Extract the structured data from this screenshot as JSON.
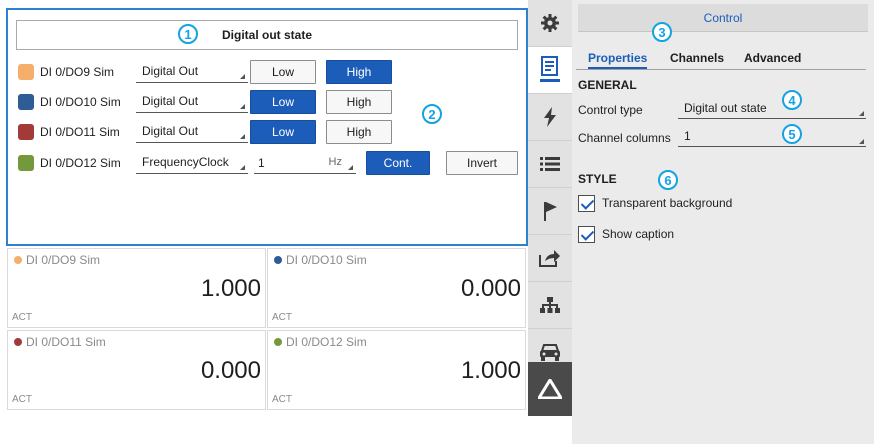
{
  "control": {
    "caption": "Digital out state",
    "rows": [
      {
        "name": "DI 0/DO9 Sim",
        "color": "#f6ae6c",
        "mode": "Digital Out",
        "low": "Low",
        "high": "High",
        "state": "high"
      },
      {
        "name": "DI 0/DO10 Sim",
        "color": "#2e5d96",
        "mode": "Digital Out",
        "low": "Low",
        "high": "High",
        "state": "low"
      },
      {
        "name": "DI 0/DO11 Sim",
        "color": "#a23a3a",
        "mode": "Digital Out",
        "low": "Low",
        "high": "High",
        "state": "low"
      },
      {
        "name": "DI 0/DO12 Sim",
        "color": "#74993d",
        "mode": "FrequencyClock",
        "freq": "1",
        "unit": "Hz",
        "cont": "Cont.",
        "invert": "Invert"
      }
    ]
  },
  "tiles": [
    {
      "name": "DI 0/DO9 Sim",
      "color": "#f6ae6c",
      "value": "1.000",
      "unit": "ACT"
    },
    {
      "name": "DI 0/DO10 Sim",
      "color": "#2e5d96",
      "value": "0.000",
      "unit": "ACT"
    },
    {
      "name": "DI 0/DO11 Sim",
      "color": "#a23a3a",
      "value": "0.000",
      "unit": "ACT"
    },
    {
      "name": "DI 0/DO12 Sim",
      "color": "#74993d",
      "value": "1.000",
      "unit": "ACT"
    }
  ],
  "sidebar_tabs": [
    "gear-icon",
    "properties-icon",
    "lightning-icon",
    "list-icon",
    "flag-icon",
    "share-icon",
    "network-icon",
    "car-icon",
    "logo-icon"
  ],
  "props": {
    "title": "Control",
    "tabs": [
      "Properties",
      "Channels",
      "Advanced"
    ],
    "general_label": "GENERAL",
    "control_type_label": "Control type",
    "control_type_value": "Digital out state",
    "channel_columns_label": "Channel columns",
    "channel_columns_value": "1",
    "style_label": "STYLE",
    "transparent_bg": "Transparent background",
    "show_caption": "Show caption"
  },
  "badges": [
    "1",
    "2",
    "3",
    "4",
    "5",
    "6"
  ],
  "colors": {
    "accent": "#1b5db9",
    "badge": "#13a3e3",
    "border_active": "#2f80d1"
  }
}
